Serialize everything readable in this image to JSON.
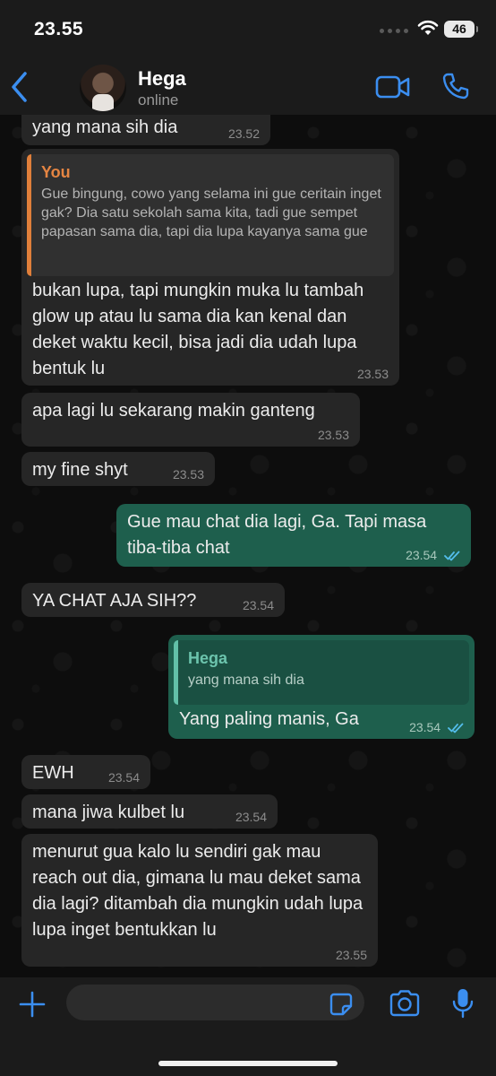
{
  "status_bar": {
    "time": "23.55",
    "battery": "46"
  },
  "header": {
    "name": "Hega",
    "status": "online"
  },
  "messages": [
    {
      "dir": "in",
      "text": "yang mana sih dia",
      "time": "23.52"
    },
    {
      "dir": "in",
      "quote": {
        "author": "You",
        "text": "Gue bingung, cowo yang selama ini gue ceritain inget gak? Dia satu sekolah sama kita, tadi gue sempet papasan sama dia, tapi dia lupa kayanya sama gue"
      },
      "text": "bukan lupa, tapi mungkin muka lu tambah glow up atau lu sama dia kan kenal dan deket waktu kecil, bisa jadi dia udah lupa bentuk lu",
      "time": "23.53"
    },
    {
      "dir": "in",
      "text": "apa lagi lu sekarang makin ganteng",
      "time": "23.53"
    },
    {
      "dir": "in",
      "text": "my fine shyt",
      "time": "23.53"
    },
    {
      "dir": "out",
      "text": "Gue mau chat dia lagi, Ga. Tapi masa tiba-tiba chat",
      "time": "23.54",
      "read": true
    },
    {
      "dir": "in",
      "text": "YA CHAT AJA SIH??",
      "time": "23.54"
    },
    {
      "dir": "out",
      "quote": {
        "author": "Hega",
        "text": "yang mana sih dia"
      },
      "text": "Yang paling manis, Ga",
      "time": "23.54",
      "read": true
    },
    {
      "dir": "in",
      "text": "EWH",
      "time": "23.54"
    },
    {
      "dir": "in",
      "text": "mana jiwa kulbet lu",
      "time": "23.54"
    },
    {
      "dir": "in",
      "text": "menurut gua kalo lu sendiri gak mau reach out dia, gimana lu mau deket sama dia lagi? ditambah dia mungkin udah lupa lupa inget bentukkan lu",
      "time": "23.55"
    }
  ],
  "input": {
    "placeholder": ""
  },
  "colors": {
    "accent": "#3b8ef0",
    "incoming_bubble": "#262626",
    "outgoing_bubble": "#1e5f4d",
    "quote_you": "#e07f3a",
    "quote_hega": "#62c0a8",
    "read_ticks": "#53bdeb"
  },
  "icons": [
    "back-chevron-icon",
    "video-call-icon",
    "phone-icon",
    "plus-icon",
    "sticker-icon",
    "camera-icon",
    "microphone-icon",
    "wifi-icon",
    "double-check-icon"
  ]
}
